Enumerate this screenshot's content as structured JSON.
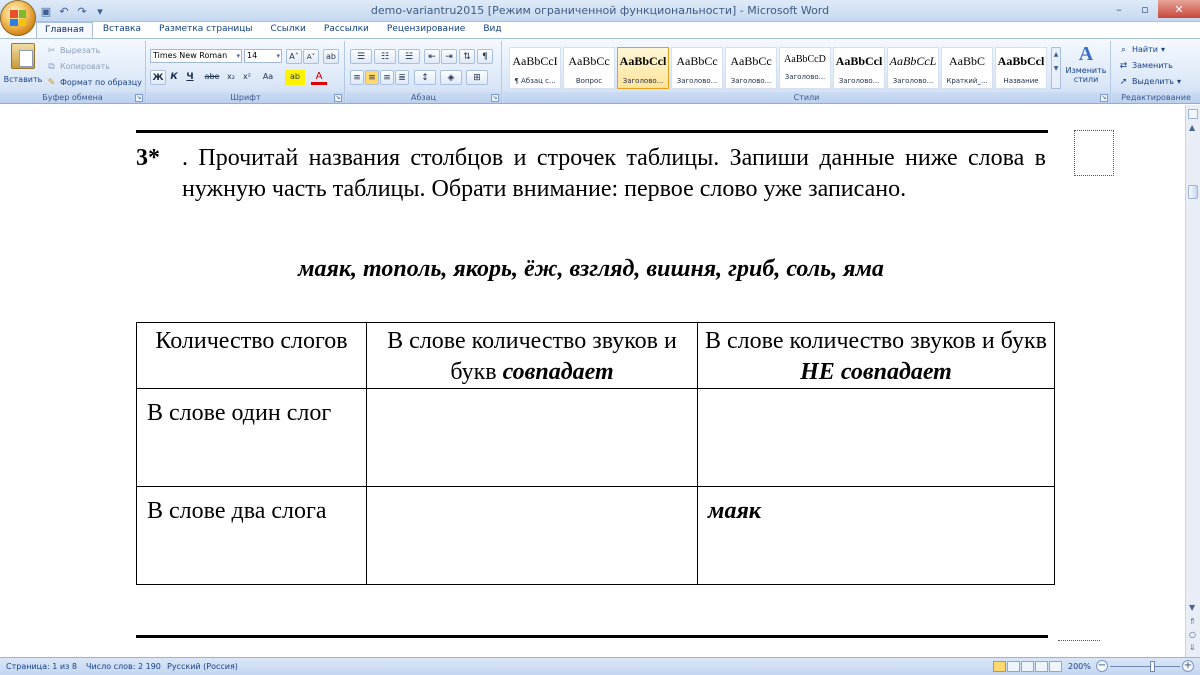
{
  "window": {
    "title": "demo-variantru2015 [Режим ограниченной функциональности] - Microsoft Word",
    "controls": [
      "–",
      "▫",
      "✕"
    ]
  },
  "tabs": [
    "Главная",
    "Вставка",
    "Разметка страницы",
    "Ссылки",
    "Рассылки",
    "Рецензирование",
    "Вид"
  ],
  "ribbon": {
    "clipboard": {
      "paste": "Вставить",
      "cut": "Вырезать",
      "copy": "Копировать",
      "format_painter": "Формат по образцу",
      "group_label": "Буфер обмена"
    },
    "font": {
      "font_name": "Times New Roman",
      "font_size": "14",
      "group_label": "Шрифт",
      "bold": "Ж",
      "italic": "К",
      "underline": "Ч",
      "strike": "abe",
      "subscript": "x₂",
      "superscript": "x²",
      "change_case": "Aa",
      "grow": "A˄",
      "shrink": "A˅",
      "clear": "ab",
      "font_color": "A",
      "highlight": "ab"
    },
    "paragraph": {
      "group_label": "Абзац",
      "show_marks": "¶"
    },
    "styles": {
      "group_label": "Стили",
      "items": [
        {
          "sample": "AaBbCcI",
          "name": "¶ Абзац с..."
        },
        {
          "sample": "AaBbCc",
          "name": "Вопрос"
        },
        {
          "sample": "AaBbCcl",
          "name": "Заголово..."
        },
        {
          "sample": "AaBbCc",
          "name": "Заголово..."
        },
        {
          "sample": "AaBbCc",
          "name": "Заголово..."
        },
        {
          "sample": "AaBbCcD",
          "name": "Заголово..."
        },
        {
          "sample": "AaBbCcl",
          "name": "Заголово..."
        },
        {
          "sample": "AaBbCcL",
          "name": "Заголово..."
        },
        {
          "sample": "AaBbC",
          "name": "Краткий_..."
        },
        {
          "sample": "AaBbCcl",
          "name": "Название"
        }
      ],
      "change_styles": "Изменить стили"
    },
    "editing": {
      "group_label": "Редактирование",
      "find": "Найти",
      "replace": "Заменить",
      "select": "Выделить"
    }
  },
  "document": {
    "task_number": "3*",
    "task_text": ". Прочитай названия столбцов и строчек таблицы. Запиши данные ниже слова в нужную часть таблицы. Обрати внимание: первое слово уже записано.",
    "words": "маяк, тополь, якорь, ёж, взгляд, вишня, гриб, соль, яма",
    "table": {
      "header": {
        "col1": "Количество слогов",
        "col2_plain": "В слове количество звуков и букв ",
        "col2_emph": "совпадает",
        "col3_plain": "В слове количество звуков и букв ",
        "col3_emph": "НЕ совпадает"
      },
      "rows": [
        {
          "label": "В слове один слог",
          "match": "",
          "nomatch": ""
        },
        {
          "label": "В слове два слога",
          "match": "",
          "nomatch": "маяк"
        }
      ]
    }
  },
  "statusbar": {
    "page": "Страница: 1 из 8",
    "words": "Число слов: 2 190",
    "language": "Русский (Россия)",
    "zoom": "200%"
  }
}
